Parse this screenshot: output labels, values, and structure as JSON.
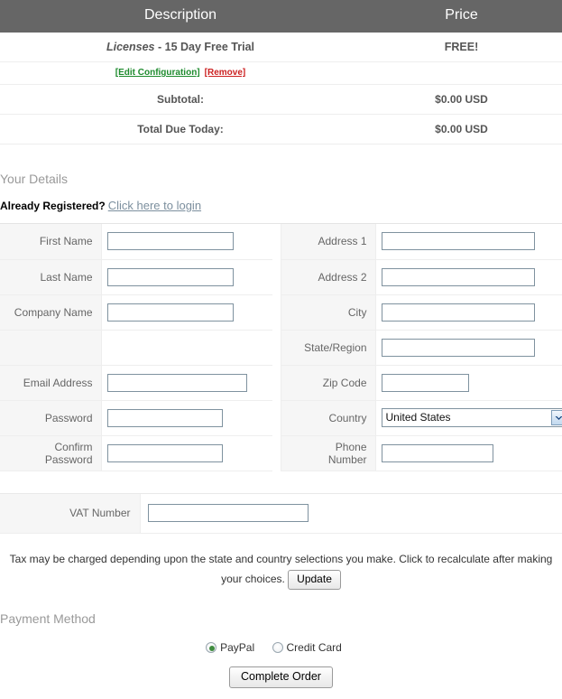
{
  "order": {
    "headers": {
      "description": "Description",
      "price": "Price"
    },
    "item": {
      "name_italic": "Licenses",
      "name_rest": " - 15 Day Free Trial",
      "price": "FREE!",
      "edit_link": "[Edit Configuration]",
      "remove_link": "[Remove]"
    },
    "subtotal_label": "Subtotal:",
    "subtotal_value": "$0.00 USD",
    "total_label": "Total Due Today:",
    "total_value": "$0.00 USD"
  },
  "details": {
    "heading": "Your Details",
    "already_registered": "Already Registered?",
    "login_link": "Click here to login",
    "fields": {
      "first_name": {
        "label": "First Name",
        "value": ""
      },
      "last_name": {
        "label": "Last Name",
        "value": ""
      },
      "company_name": {
        "label": "Company Name",
        "value": ""
      },
      "email_address": {
        "label": "Email Address",
        "value": ""
      },
      "password": {
        "label": "Password",
        "value": ""
      },
      "confirm_password": {
        "label": "Confirm\nPassword",
        "value": ""
      },
      "address1": {
        "label": "Address 1",
        "value": ""
      },
      "address2": {
        "label": "Address 2",
        "value": ""
      },
      "city": {
        "label": "City",
        "value": ""
      },
      "state_region": {
        "label": "State/Region",
        "value": ""
      },
      "zip_code": {
        "label": "Zip Code",
        "value": ""
      },
      "country": {
        "label": "Country",
        "value": "United States"
      },
      "phone_number": {
        "label": "Phone\nNumber",
        "value": ""
      }
    }
  },
  "vat": {
    "label": "VAT Number",
    "value": ""
  },
  "tax_note": {
    "text": "Tax may be charged depending upon the state and country selections you make. Click to recalculate after making your choices.",
    "update_button": "Update"
  },
  "payment": {
    "heading": "Payment Method",
    "options": [
      {
        "label": "PayPal",
        "selected": true
      },
      {
        "label": "Credit Card",
        "selected": false
      }
    ],
    "submit_button": "Complete Order"
  },
  "colors": {
    "header_bg": "#666666",
    "link_edit": "#1e8b2e",
    "link_remove": "#cc2222",
    "login_link": "#7c8f9e",
    "input_border": "#7f929f",
    "radio_dot": "#3f8c3f",
    "label_bg": "#f6f6f6"
  }
}
